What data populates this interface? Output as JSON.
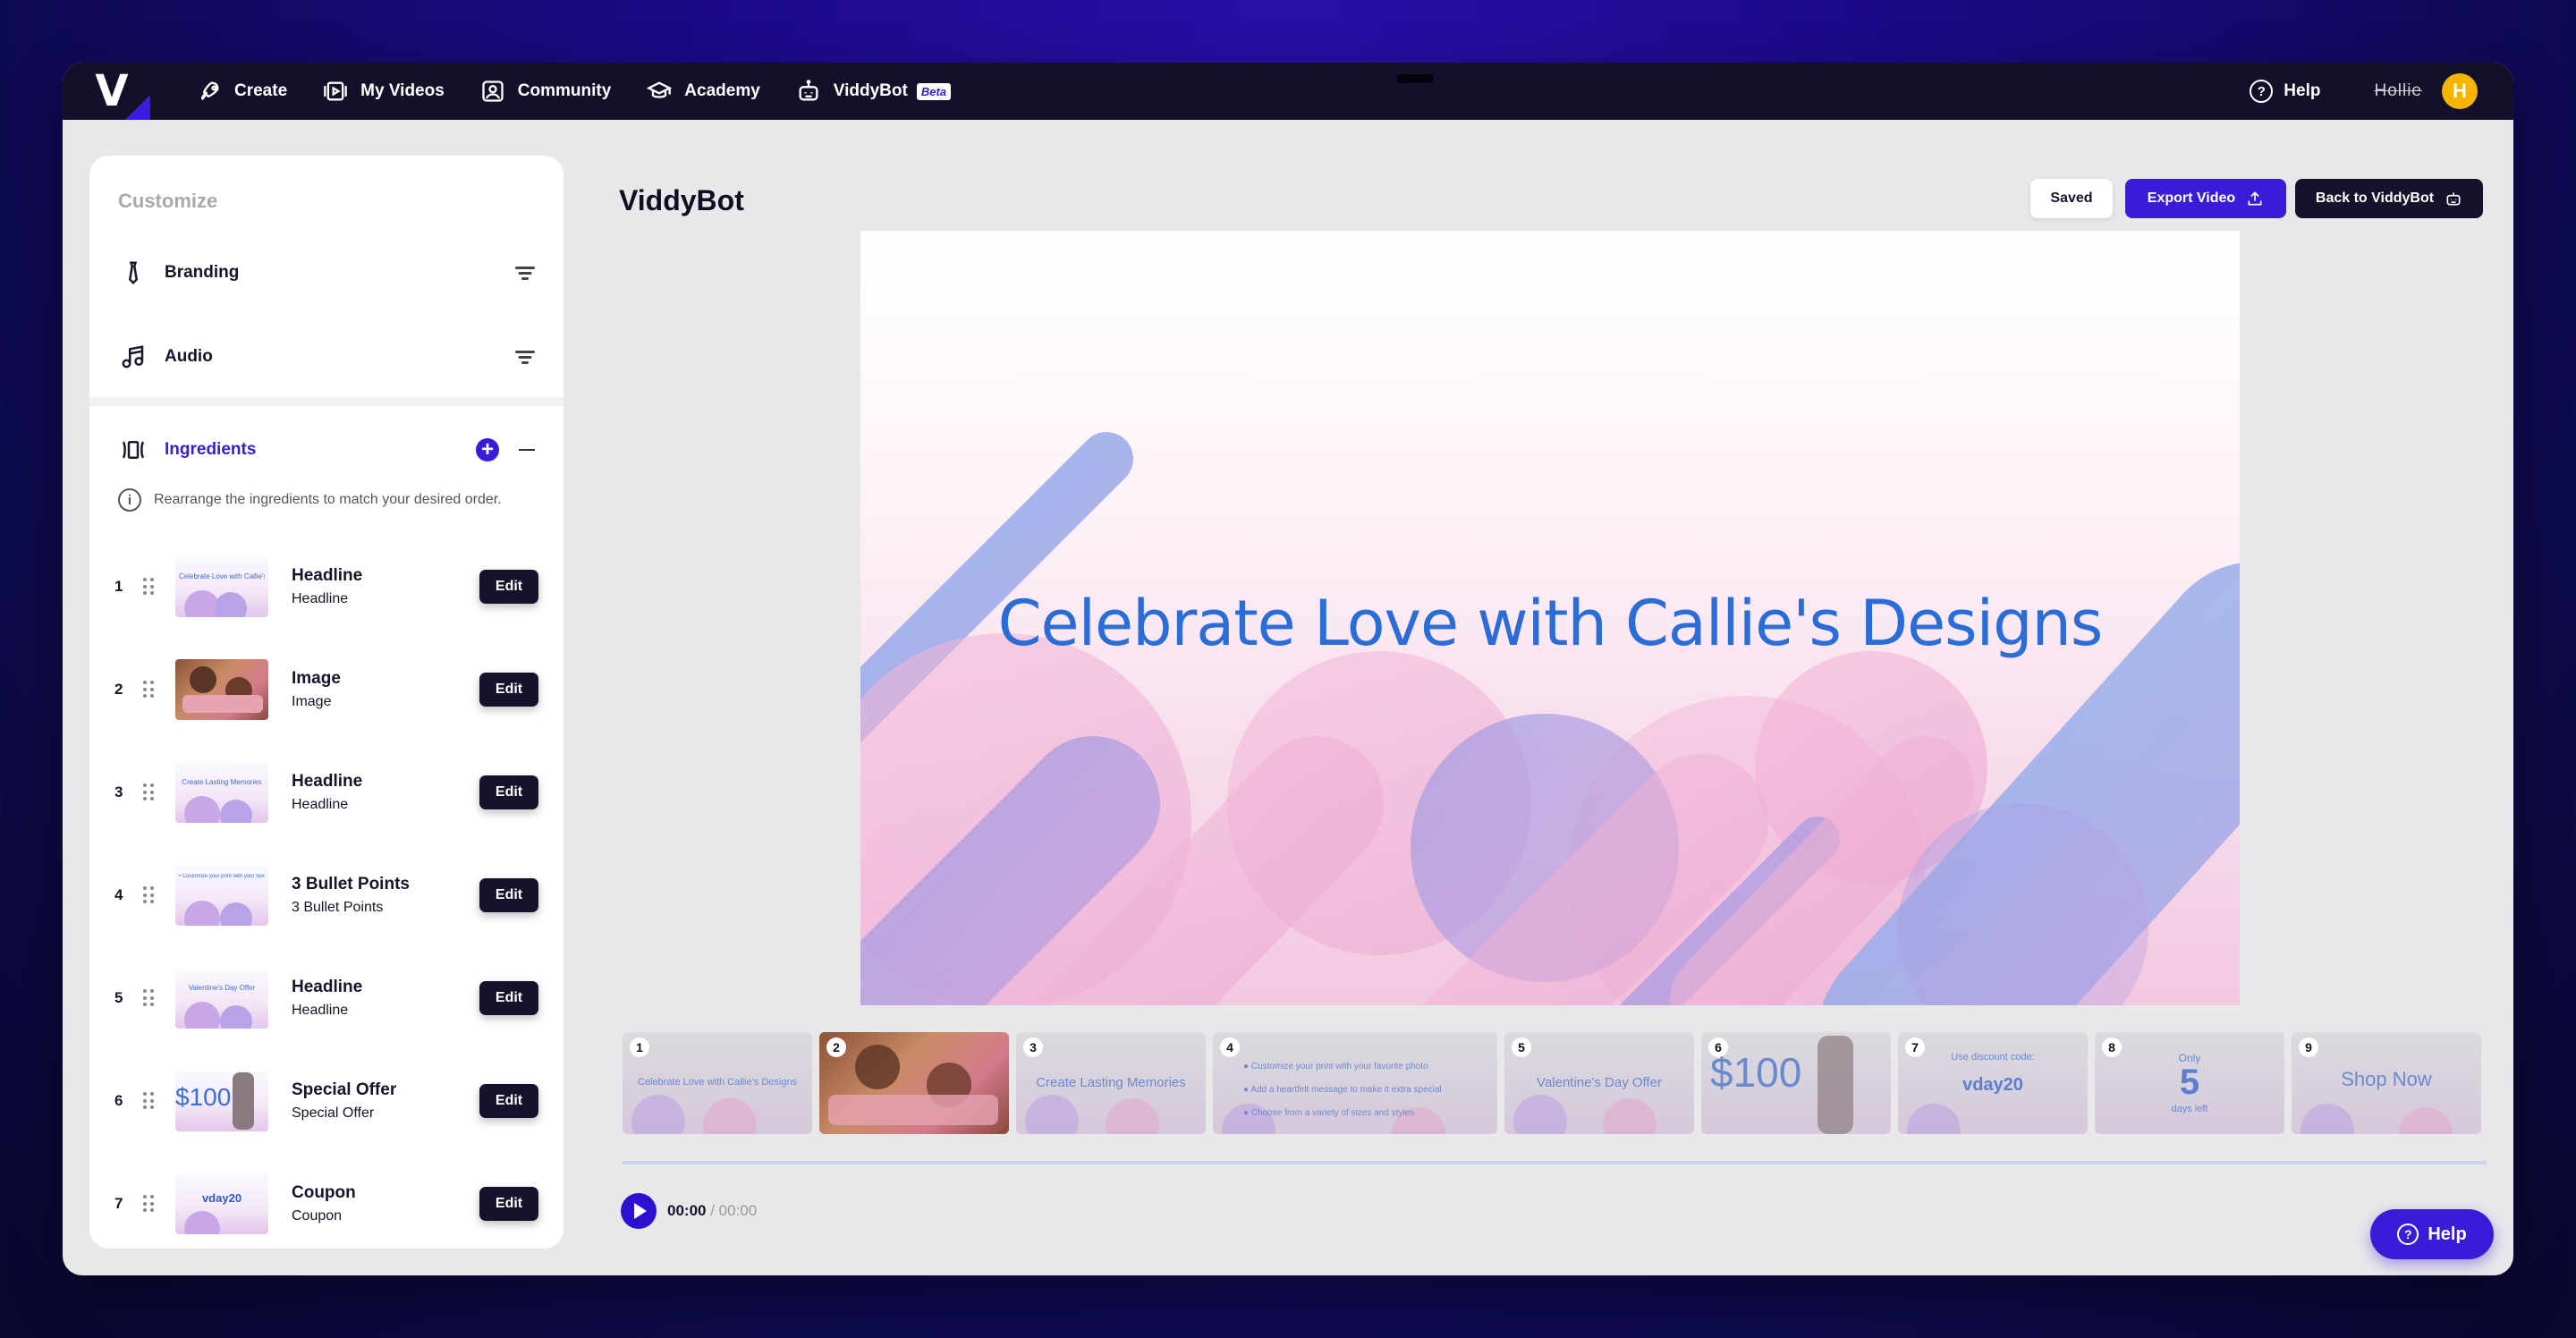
{
  "nav": {
    "logo": "V",
    "items": [
      {
        "label": "Create",
        "icon": "rocket-icon"
      },
      {
        "label": "My Videos",
        "icon": "videos-icon"
      },
      {
        "label": "Community",
        "icon": "community-icon"
      },
      {
        "label": "Academy",
        "icon": "graduation-cap-icon"
      },
      {
        "label": "ViddyBot",
        "icon": "robot-icon",
        "badge": "Beta"
      }
    ],
    "help": "Help",
    "user_name": "Hollie",
    "avatar_initial": "H"
  },
  "sidebar": {
    "title": "Customize",
    "branding": "Branding",
    "audio": "Audio",
    "ingredients": "Ingredients",
    "info": "Rearrange the ingredients to match your desired order.",
    "edit_label": "Edit",
    "items": [
      {
        "num": "1",
        "title": "Headline",
        "sub": "Headline",
        "thumb_text": "Celebrate Love with Callie's Designs"
      },
      {
        "num": "2",
        "title": "Image",
        "sub": "Image",
        "thumb_text": ""
      },
      {
        "num": "3",
        "title": "Headline",
        "sub": "Headline",
        "thumb_text": "Create Lasting Memories"
      },
      {
        "num": "4",
        "title": "3 Bullet Points",
        "sub": "3 Bullet Points",
        "thumb_text": "• Customize your print with your favorite photo"
      },
      {
        "num": "5",
        "title": "Headline",
        "sub": "Headline",
        "thumb_text": "Valentine's Day Offer"
      },
      {
        "num": "6",
        "title": "Special Offer",
        "sub": "Special Offer",
        "thumb_text": "$100"
      },
      {
        "num": "7",
        "title": "Coupon",
        "sub": "Coupon",
        "thumb_text": "vday20"
      }
    ]
  },
  "main": {
    "title": "ViddyBot",
    "saved": "Saved",
    "export": "Export Video",
    "back": "Back to ViddyBot",
    "preview_title": "Celebrate Love with Callie's Designs",
    "accent": "#3a1bd8"
  },
  "timeline": [
    {
      "num": "1",
      "text": "Celebrate Love with Callie's Designs"
    },
    {
      "num": "2",
      "text": ""
    },
    {
      "num": "3",
      "text": "Create Lasting Memories"
    },
    {
      "num": "4",
      "bullets": [
        "Customize your print with your favorite photo",
        "Add a heartfelt message to make it extra special",
        "Choose from a variety of sizes and styles"
      ]
    },
    {
      "num": "5",
      "text": "Valentine's Day Offer"
    },
    {
      "num": "6",
      "text": "$100"
    },
    {
      "num": "7",
      "line1": "Use discount code:",
      "text": "vday20"
    },
    {
      "num": "8",
      "line1": "Only",
      "big": "5",
      "line2": "days left"
    },
    {
      "num": "9",
      "text": "Shop Now"
    }
  ],
  "player": {
    "current": "00:00",
    "duration": "00:00"
  },
  "help_fab": "Help"
}
